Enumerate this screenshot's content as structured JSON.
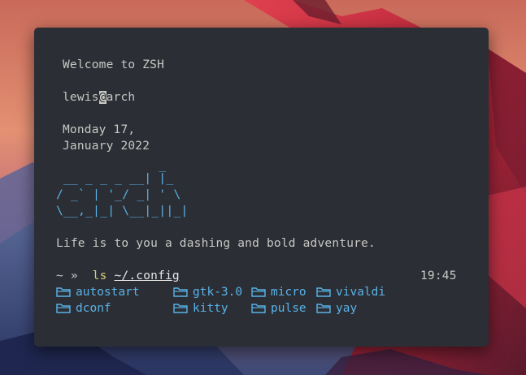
{
  "colors": {
    "terminal_bg": "#2b2e35",
    "text": "#c8c8c3",
    "accent_blue": "#5ab3e8",
    "command_yellow": "#d6d17a"
  },
  "terminal": {
    "welcome": "Welcome to ZSH",
    "user": "lewis",
    "at": "@",
    "host": "arch",
    "date_line1": "Monday 17,",
    "date_line2": "January 2022",
    "ascii_art": [
      "              _",
      " __ _ _ _ __| |_",
      "/ _` | '_/ _| ' \\",
      "\\__,_|_| \\__|_||_|"
    ],
    "fortune": "Life is to you a dashing and bold adventure.",
    "prompt": "~ »",
    "command": "ls",
    "argument": "~/.config",
    "time": "19:45",
    "listing": [
      {
        "name": "autostart",
        "icon": "folder-icon"
      },
      {
        "name": "gtk-3.0",
        "icon": "folder-icon"
      },
      {
        "name": "micro",
        "icon": "folder-icon"
      },
      {
        "name": "vivaldi",
        "icon": "folder-icon"
      },
      {
        "name": "dconf",
        "icon": "folder-icon"
      },
      {
        "name": "kitty",
        "icon": "folder-icon"
      },
      {
        "name": "pulse",
        "icon": "folder-icon"
      },
      {
        "name": "yay",
        "icon": "folder-icon"
      }
    ]
  }
}
